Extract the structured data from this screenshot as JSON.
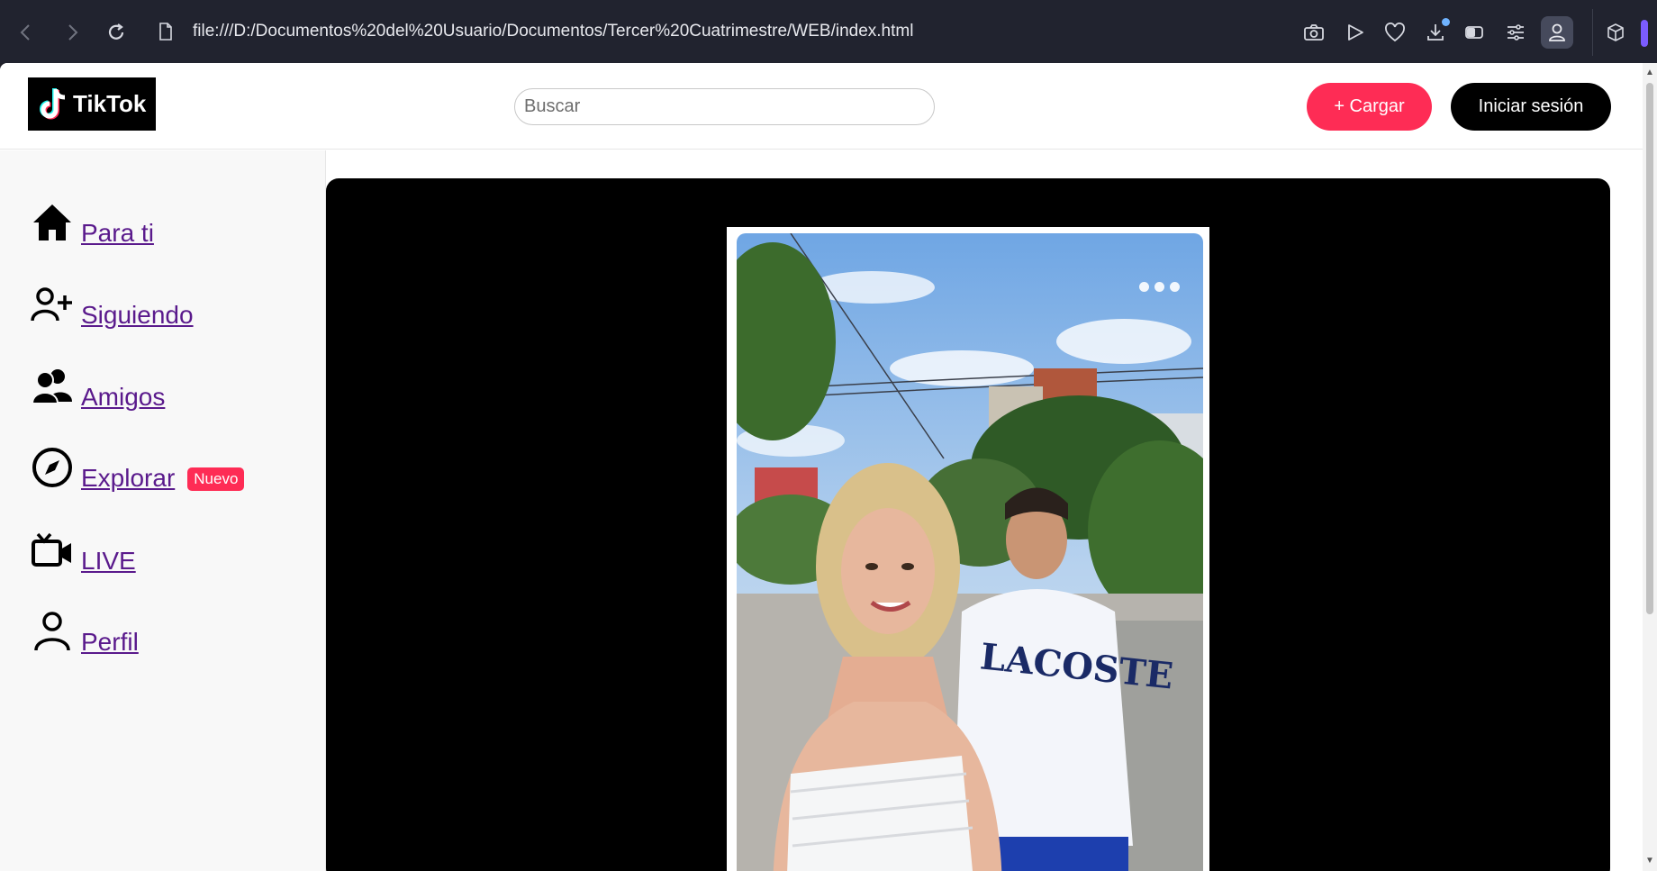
{
  "browser": {
    "url": "file:///D:/Documentos%20del%20Usuario/Documentos/Tercer%20Cuatrimestre/WEB/index.html"
  },
  "header": {
    "logo_text": "TikTok",
    "search_placeholder": "Buscar",
    "upload_label": "+ Cargar",
    "login_label": "Iniciar sesión"
  },
  "sidebar": {
    "items": [
      {
        "label": "Para ti",
        "icon": "home-icon"
      },
      {
        "label": "Siguiendo",
        "icon": "user-plus-icon"
      },
      {
        "label": "Amigos",
        "icon": "friends-icon"
      },
      {
        "label": "Explorar",
        "icon": "compass-icon",
        "badge": "Nuevo"
      },
      {
        "label": "LIVE",
        "icon": "live-camera-icon"
      },
      {
        "label": "Perfil",
        "icon": "profile-icon"
      }
    ]
  },
  "colors": {
    "accent": "#fe2c55",
    "link": "#5a1a8c",
    "browser_bg": "#21232f"
  }
}
